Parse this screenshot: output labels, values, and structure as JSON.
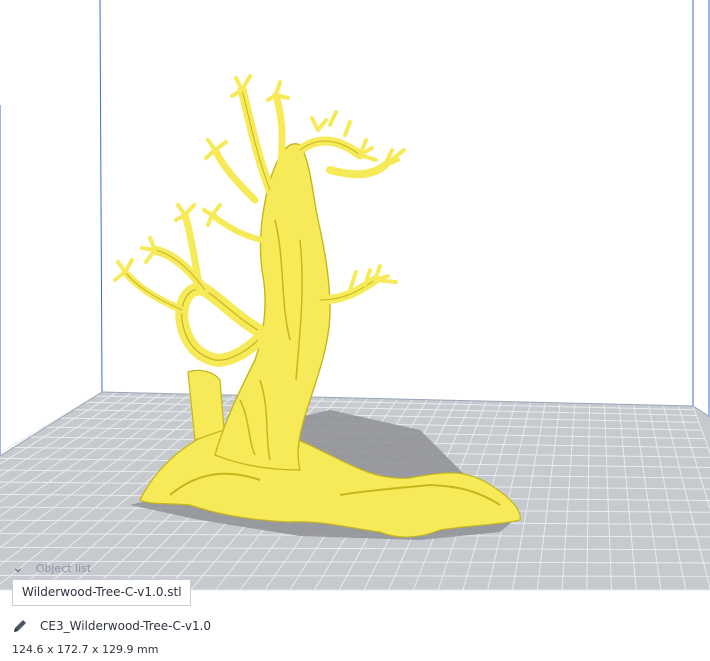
{
  "viewport": {
    "build_plate_color": "#c6c9ce",
    "grid_line_color": "#e9ebee",
    "volume_edge_color": "#3c6ecf",
    "model_color": "#f7ea58",
    "model_shade_color": "#c7b51c",
    "shadow_color": "#8e9096"
  },
  "object_list": {
    "header_label": "Object list",
    "chevron_icon": "chevron-down-icon",
    "file_name": "Wilderwood-Tree-C-v1.0.stl",
    "edit_icon": "pencil-icon",
    "object_name": "CE3_Wilderwood-Tree-C-v1.0",
    "dimensions": "124.6 x 172.7 x 129.9 mm"
  }
}
